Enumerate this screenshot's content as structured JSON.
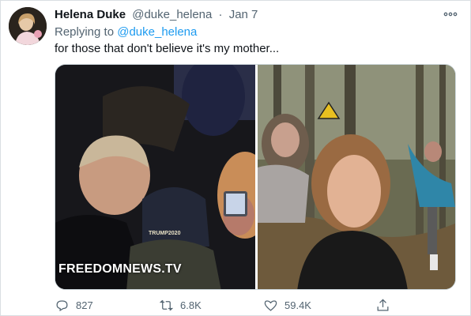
{
  "tweet": {
    "author_name": "Helena Duke",
    "author_handle": "@duke_helena",
    "separator": "·",
    "date": "Jan 7",
    "more_icon": "more-icon",
    "replying_prefix": "Replying to",
    "replying_handle": "@duke_helena",
    "text": "for those that don't believe it's my mother...",
    "media_watermark": "FREEDOMNEWS.TV",
    "left_photo_cap_text": "TRUMP2020"
  },
  "actions": {
    "reply_count": "827",
    "retweet_count": "6.8K",
    "like_count": "59.4K",
    "icons": [
      "reply-icon",
      "retweet-icon",
      "like-icon",
      "share-icon"
    ]
  },
  "colors": {
    "name": "#0f1419",
    "meta": "#536471",
    "link": "#1d9bf0",
    "border": "#cfd9de"
  }
}
